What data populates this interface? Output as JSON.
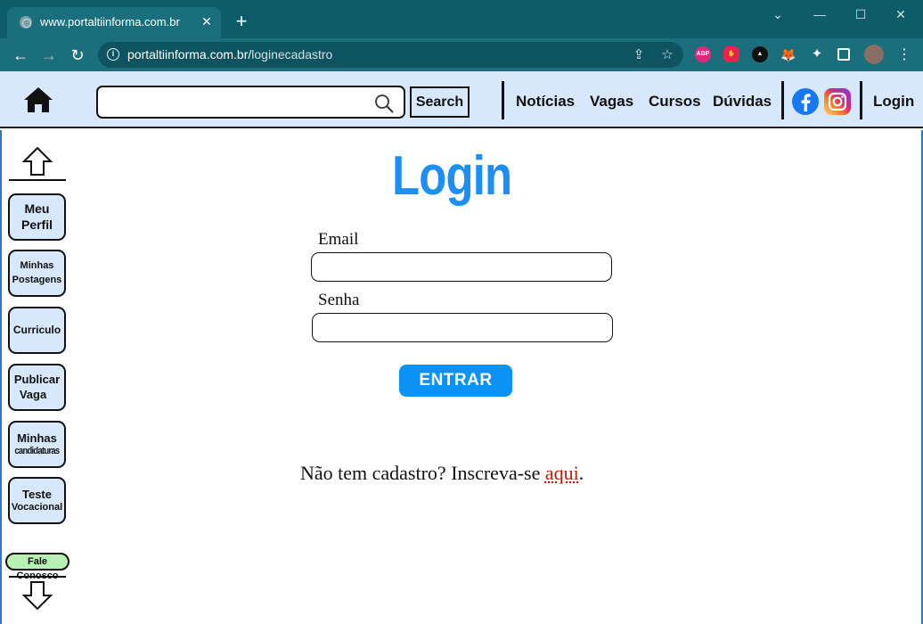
{
  "browser": {
    "tab_title": "www.portaltiinforma.com.br",
    "url_host": "portaltiinforma.com.br/",
    "url_path": "loginecadastro",
    "extensions": [
      "ABP"
    ]
  },
  "header": {
    "search_placeholder": "",
    "search_button": "Search",
    "nav": [
      "Notícias",
      "Vagas",
      "Cursos",
      "Dúvidas"
    ],
    "login": "Login"
  },
  "sidebar": {
    "items": [
      {
        "line1": "Meu",
        "line2": "Perfil"
      },
      {
        "line1": "Minhas",
        "line2": "Postagens"
      },
      {
        "line1": "Curriculo",
        "line2": ""
      },
      {
        "line1": "Publicar",
        "line2": "Vaga"
      },
      {
        "line1": "Minhas",
        "line2": "candidaturas"
      },
      {
        "line1": "Teste",
        "line2": "Vocacional"
      }
    ],
    "contact": "Fale Conosco"
  },
  "main": {
    "title": "Login",
    "email_label": "Email",
    "email_value": "",
    "password_label": "Senha",
    "password_value": "",
    "submit": "ENTRAR",
    "signup_text": "Não tem cadastro? Inscreva-se ",
    "signup_link": "aqui",
    "signup_end": "."
  },
  "colors": {
    "header_bg": "#d7e8fc",
    "accent_blue": "#0c91f5",
    "link_red": "#c01a0e",
    "contact_green": "#b9f0b3"
  }
}
